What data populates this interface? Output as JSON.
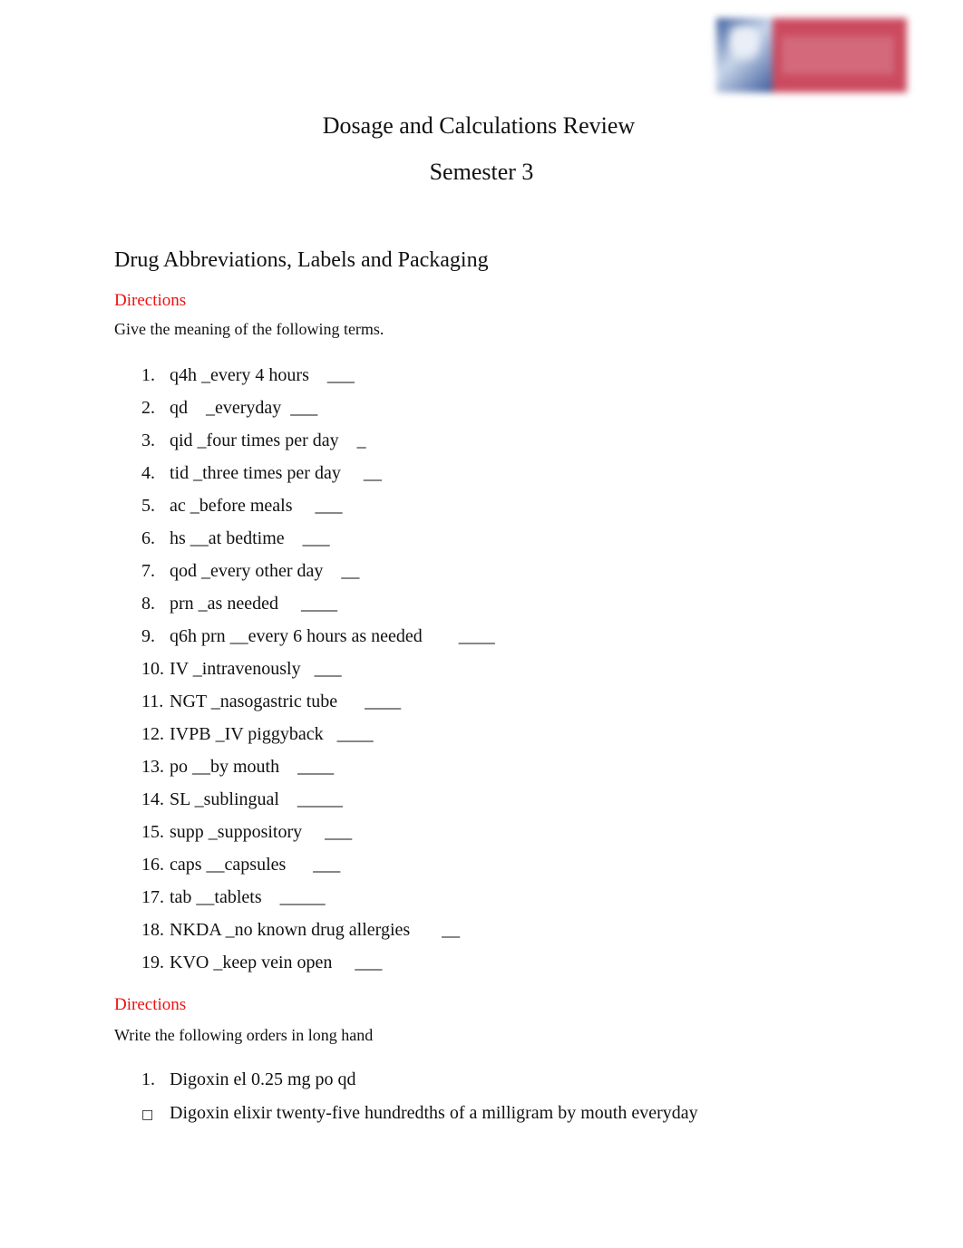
{
  "header": {
    "logo_alt": "institution-logo",
    "title": "Dosage and Calculations Review",
    "subtitle": "Semester 3"
  },
  "section": {
    "heading": "Drug Abbreviations, Labels and Packaging"
  },
  "part1": {
    "directions_label": "Directions",
    "instruction": "Give the meaning of the following terms.",
    "terms": [
      {
        "num": "1.",
        "text": "q4h _every 4 hours    ___"
      },
      {
        "num": "2.",
        "text": "qd    _everyday  ___"
      },
      {
        "num": "3.",
        "text": "qid _four times per day    _"
      },
      {
        "num": "4.",
        "text": "tid _three times per day     __"
      },
      {
        "num": "5.",
        "text": "ac _before meals     ___"
      },
      {
        "num": "6.",
        "text": "hs __at bedtime    ___"
      },
      {
        "num": "7.",
        "text": "qod _every other day    __"
      },
      {
        "num": "8.",
        "text": "prn _as needed     ____"
      },
      {
        "num": "9.",
        "text": "q6h prn __every 6 hours as needed        ____"
      },
      {
        "num": "10.",
        "text": "IV _intravenously   ___"
      },
      {
        "num": "11.",
        "text": "NGT _nasogastric tube      ____"
      },
      {
        "num": "12.",
        "text": "IVPB _IV piggyback   ____"
      },
      {
        "num": "13.",
        "text": "po __by mouth    ____"
      },
      {
        "num": "14.",
        "text": "SL _sublingual    _____"
      },
      {
        "num": "15.",
        "text": "supp _suppository     ___"
      },
      {
        "num": "16.",
        "text": "caps __capsules      ___"
      },
      {
        "num": "17.",
        "text": "tab __tablets    _____"
      },
      {
        "num": "18.",
        "text": "NKDA _no known drug allergies       __"
      },
      {
        "num": "19.",
        "text": "KVO _keep vein open     ___"
      }
    ]
  },
  "part2": {
    "directions_label": "Directions",
    "instruction": "Write the following orders in long hand",
    "orders": [
      {
        "num": "1.",
        "text": "Digoxin el 0.25 mg po qd"
      }
    ],
    "answers": [
      {
        "bullet": "",
        "text": "Digoxin elixir twenty-five hundredths of a milligram by mouth everyday"
      }
    ]
  }
}
